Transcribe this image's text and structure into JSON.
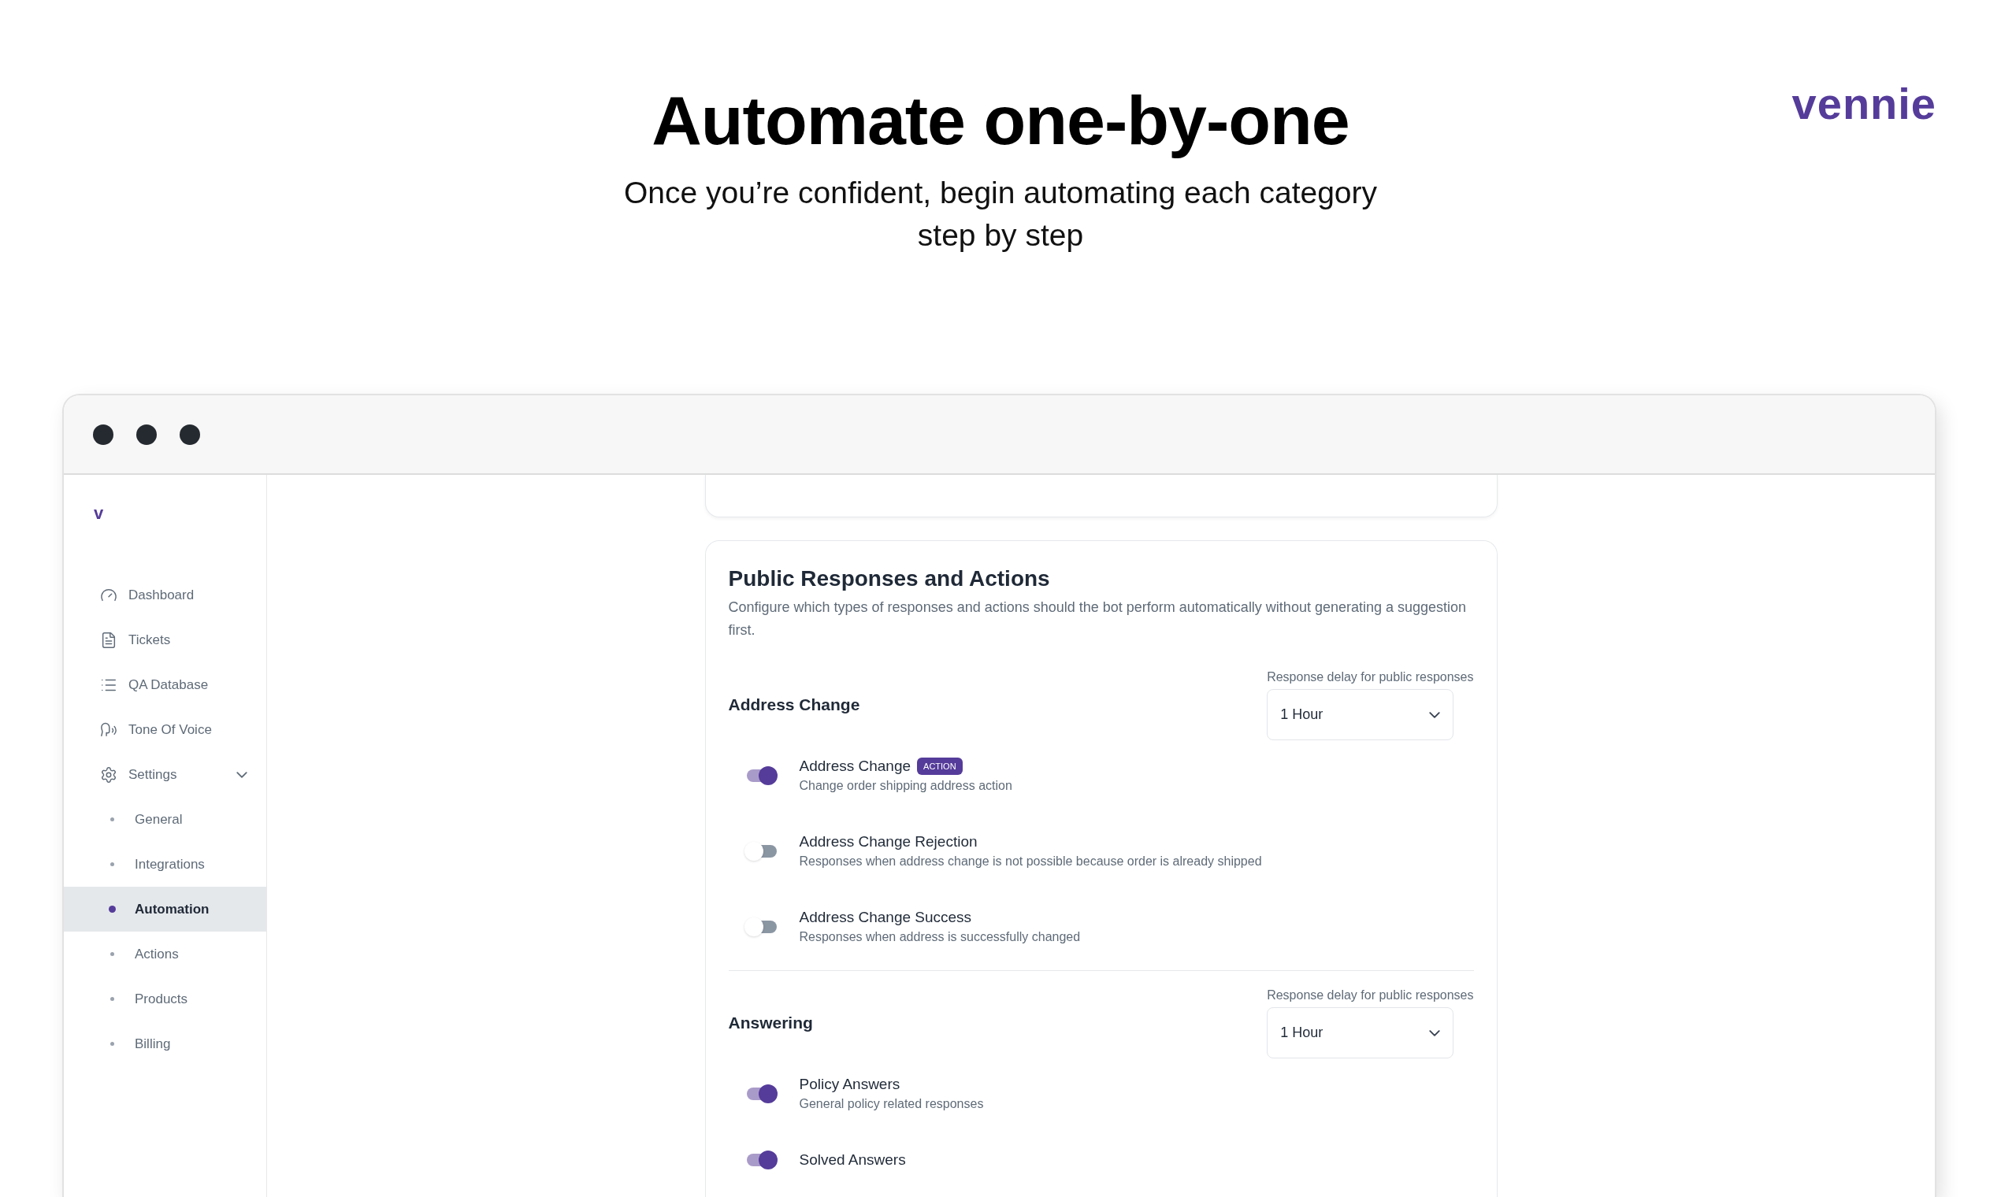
{
  "hero": {
    "title": "Automate one-by-one",
    "subtitle": "Once you’re confident, begin automating each category step by step",
    "logo": "vennie"
  },
  "sidebar": {
    "logo": "v",
    "items": [
      {
        "label": "Dashboard",
        "selected": false
      },
      {
        "label": "Tickets",
        "selected": false
      },
      {
        "label": "QA Database",
        "selected": false
      },
      {
        "label": "Tone Of Voice",
        "selected": false
      },
      {
        "label": "Settings",
        "selected": false,
        "expanded": true,
        "children": [
          {
            "label": "General",
            "selected": false
          },
          {
            "label": "Integrations",
            "selected": false
          },
          {
            "label": "Automation",
            "selected": true
          },
          {
            "label": "Actions",
            "selected": false
          },
          {
            "label": "Products",
            "selected": false
          },
          {
            "label": "Billing",
            "selected": false
          }
        ]
      }
    ]
  },
  "card": {
    "title": "Public Responses and Actions",
    "description": "Configure which types of responses and actions should the bot perform automatically without generating a suggestion first.",
    "sections": [
      {
        "title": "Address Change",
        "delay_label": "Response delay for public responses",
        "delay_value": "1 Hour",
        "items": [
          {
            "title": "Address Change",
            "badge": "ACTION",
            "description": "Change order shipping address action",
            "on": true
          },
          {
            "title": "Address Change Rejection",
            "description": "Responses when address change is not possible because order is already shipped",
            "on": false
          },
          {
            "title": "Address Change Success",
            "description": "Responses when address is successfully changed",
            "on": false
          }
        ]
      },
      {
        "title": "Answering",
        "delay_label": "Response delay for public responses",
        "delay_value": "1 Hour",
        "items": [
          {
            "title": "Policy Answers",
            "description": "General policy related responses",
            "on": true
          },
          {
            "title": "Solved Answers",
            "on": true
          }
        ]
      }
    ]
  }
}
